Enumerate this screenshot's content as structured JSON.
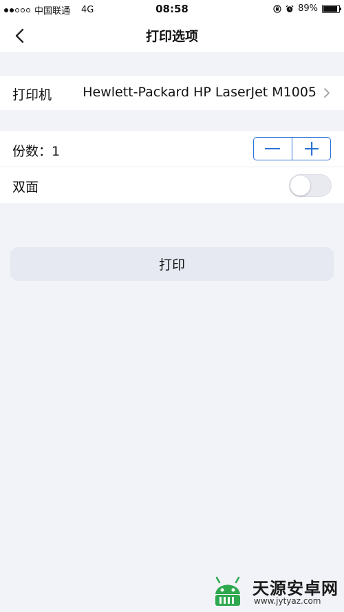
{
  "status_bar": {
    "carrier": "中国联通",
    "network": "4G",
    "time": "08:58",
    "battery": "89%",
    "battery_level": 0.89
  },
  "nav": {
    "title": "打印选项",
    "back_icon": "chevron-left-icon"
  },
  "printer_row": {
    "label": "打印机",
    "value": "Hewlett-Packard HP LaserJet M1005"
  },
  "copies_row": {
    "label": "份数：1",
    "minus_icon": "minus-icon",
    "plus_icon": "plus-icon"
  },
  "duplex_row": {
    "label": "双面",
    "enabled": false
  },
  "print_button": {
    "label": "打印"
  },
  "watermark": {
    "title": "天源安卓网",
    "url": "www.jytyaz.com"
  },
  "colors": {
    "accent": "#2b74d8",
    "background": "#f1f3f8",
    "button_bg": "#e6e9f1",
    "watermark_green": "#2fa84f"
  }
}
